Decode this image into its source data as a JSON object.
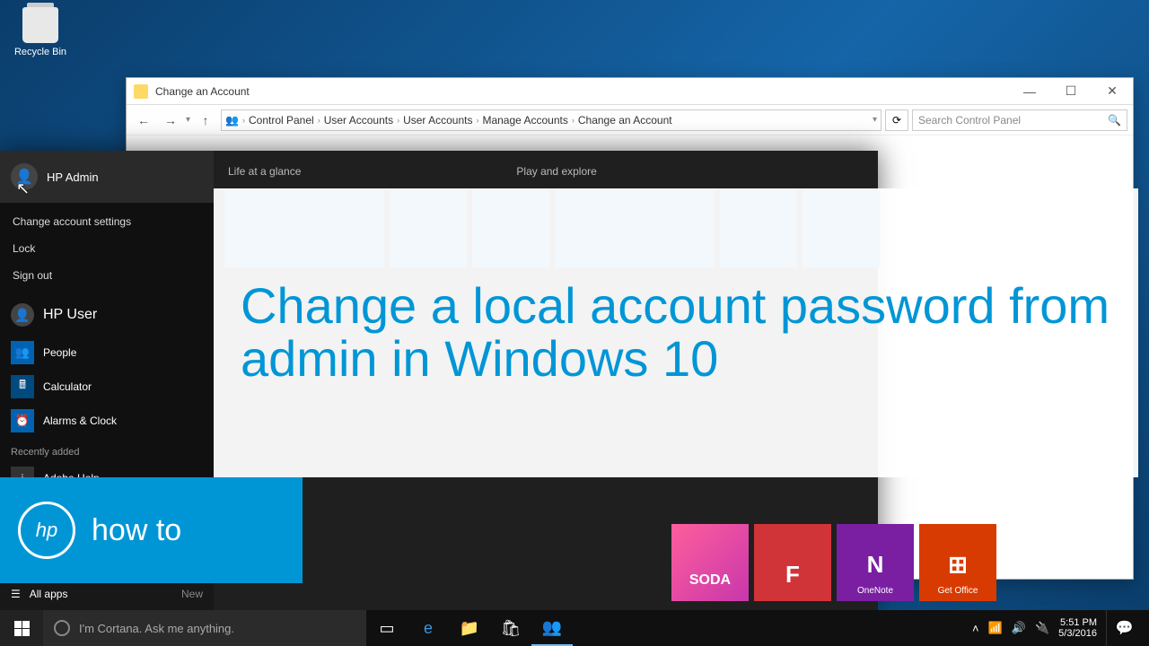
{
  "desktop": {
    "recycle_bin": "Recycle Bin"
  },
  "window": {
    "title": "Change an Account",
    "breadcrumb": [
      "Control Panel",
      "User Accounts",
      "User Accounts",
      "Manage Accounts",
      "Change an Account"
    ],
    "search_placeholder": "Search Control Panel",
    "controls": {
      "min": "—",
      "max": "☐",
      "close": "✕"
    }
  },
  "start_menu": {
    "current_user": "HP Admin",
    "user_menu": [
      "Change account settings",
      "Lock",
      "Sign out"
    ],
    "other_user": "HP User",
    "apps": [
      {
        "label": "People",
        "color": "ai-blue"
      },
      {
        "label": "Calculator",
        "color": "ai-dblue"
      },
      {
        "label": "Alarms & Clock",
        "color": "ai-blue"
      }
    ],
    "recently_added_header": "Recently added",
    "recent_app": "Adobe Help",
    "all_apps": "All apps",
    "new_label": "New",
    "headers": {
      "left": "Life at a glance",
      "right": "Play and explore"
    },
    "bottom_tiles": [
      {
        "label": "",
        "icon": "SODA",
        "class": "t-candy"
      },
      {
        "label": "",
        "icon": "F",
        "class": "t-red"
      },
      {
        "label": "OneNote",
        "icon": "N",
        "class": "t-purple"
      },
      {
        "label": "Get Office",
        "icon": "⊞",
        "class": "t-orange"
      }
    ]
  },
  "overlay": {
    "title": "Change a local account password from admin in Windows 10",
    "brand": "hp",
    "howto": "how to"
  },
  "taskbar": {
    "cortana_placeholder": "I'm Cortana. Ask me anything.",
    "time": "5:51 PM",
    "date": "5/3/2016"
  }
}
